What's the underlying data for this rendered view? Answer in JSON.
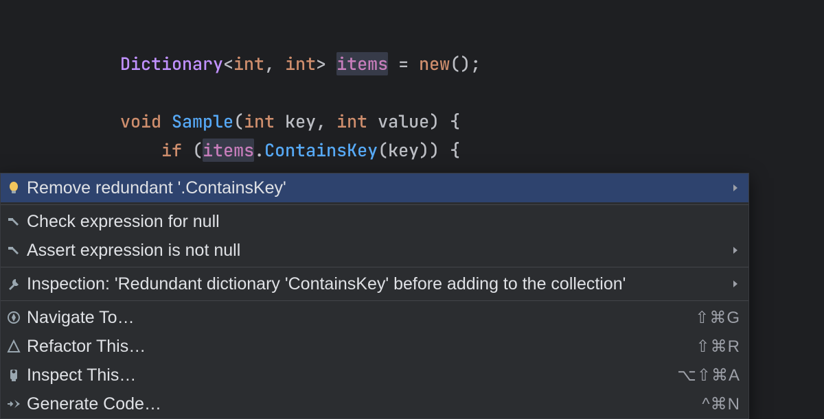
{
  "code": {
    "decl_type": "Dictionary",
    "decl_gen1": "int",
    "decl_gen2": "int",
    "decl_name": "items",
    "decl_new": "new",
    "fn_kw": "void",
    "fn_name": "Sample",
    "fn_p1t": "int",
    "fn_p1n": "key",
    "fn_p2t": "int",
    "fn_p2n": "value",
    "if_kw": "if",
    "if_field": "items",
    "if_call": "ContainsKey",
    "if_arg": "key"
  },
  "popup": {
    "items": [
      {
        "icon": "bulb",
        "label": "Remove redundant '.ContainsKey'",
        "submenu": true,
        "selected": true
      },
      {
        "sep": true
      },
      {
        "icon": "hammer",
        "label": "Check expression for null"
      },
      {
        "icon": "hammer",
        "label": "Assert expression is not null",
        "submenu": true
      },
      {
        "sep": true
      },
      {
        "icon": "wrench",
        "label": "Inspection: 'Redundant dictionary 'ContainsKey' before adding to the collection'",
        "submenu": true
      },
      {
        "sep": true
      },
      {
        "icon": "compass",
        "label": "Navigate To…",
        "shortcut": "⇧⌘G"
      },
      {
        "icon": "shape",
        "label": "Refactor This…",
        "shortcut": "⇧⌘R"
      },
      {
        "icon": "inspect",
        "label": "Inspect This…",
        "shortcut": "⌥⇧⌘A"
      },
      {
        "icon": "gen",
        "label": "Generate Code…",
        "shortcut": "^⌘N"
      }
    ]
  }
}
